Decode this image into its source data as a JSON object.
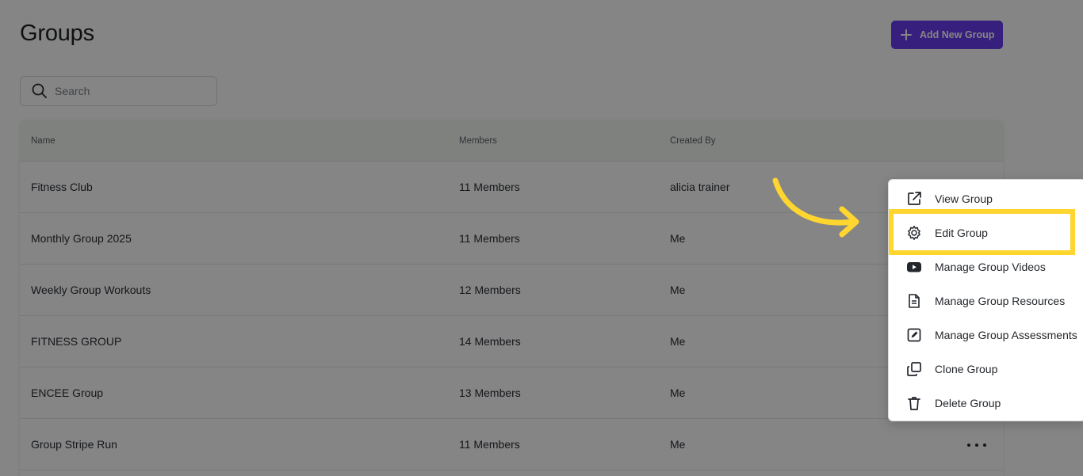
{
  "header": {
    "title": "Groups",
    "add_button_label": "Add New Group"
  },
  "search": {
    "placeholder": "Search"
  },
  "table": {
    "columns": [
      "Name",
      "Members",
      "Created By"
    ],
    "rows": [
      {
        "name": "Fitness Club",
        "members": "11 Members",
        "created_by": "alicia trainer"
      },
      {
        "name": "Monthly Group 2025",
        "members": "11 Members",
        "created_by": "Me"
      },
      {
        "name": "Weekly Group Workouts",
        "members": "12 Members",
        "created_by": "Me"
      },
      {
        "name": "FITNESS GROUP",
        "members": "14 Members",
        "created_by": "Me"
      },
      {
        "name": "ENCEE Group",
        "members": "13 Members",
        "created_by": "Me"
      },
      {
        "name": "Group Stripe Run",
        "members": "11 Members",
        "created_by": "Me"
      }
    ]
  },
  "menu": {
    "items": [
      {
        "label": "View Group",
        "icon": "external-link-icon"
      },
      {
        "label": "Edit Group",
        "icon": "gear-icon"
      },
      {
        "label": "Manage Group Videos",
        "icon": "youtube-icon"
      },
      {
        "label": "Manage Group Resources",
        "icon": "document-icon"
      },
      {
        "label": "Manage Group Assessments",
        "icon": "edit-square-icon"
      },
      {
        "label": "Clone Group",
        "icon": "copy-icon"
      },
      {
        "label": "Delete Group",
        "icon": "trash-icon"
      }
    ],
    "highlighted_item": "Edit Group"
  },
  "colors": {
    "primary": "#6a3df0",
    "highlight": "#ffd630",
    "arrow": "#ffd630",
    "overlay": "rgba(0,0,0,0.48)"
  }
}
